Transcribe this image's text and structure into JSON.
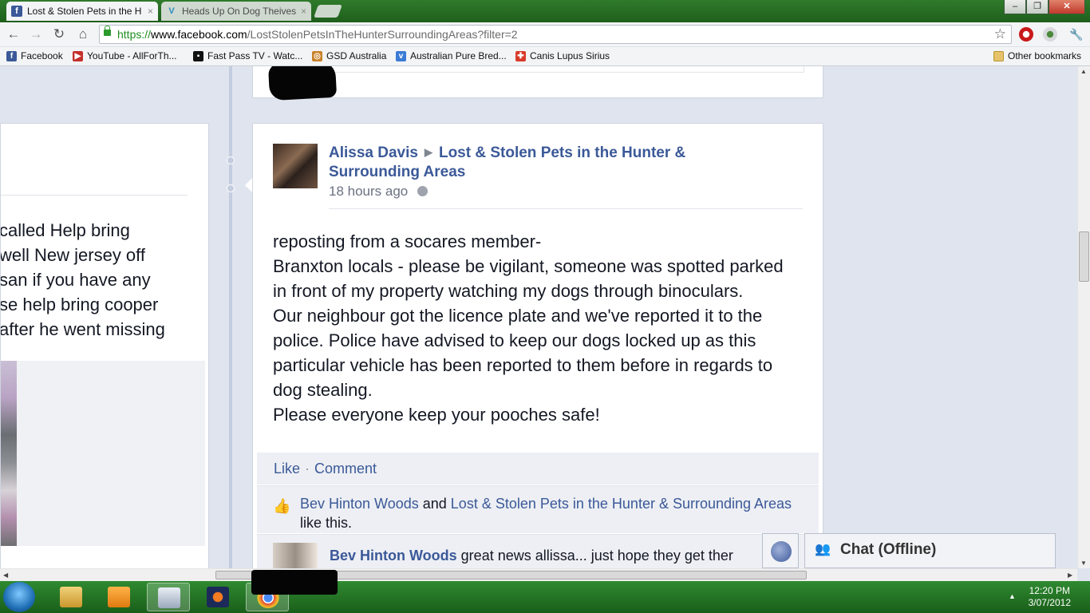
{
  "browser": {
    "tabs": [
      {
        "title": "Lost & Stolen Pets in the H",
        "active": true
      },
      {
        "title": "Heads Up On Dog Theives",
        "active": false
      }
    ],
    "close_glyph": "×",
    "window_controls": {
      "minimize": "–",
      "maximize": "❐",
      "close": "✕"
    },
    "url": {
      "scheme": "https://",
      "domain": "www.facebook.com",
      "path": "/LostStolenPetsInTheHunterSurroundingAreas?filter=2"
    },
    "nav": {
      "back": "←",
      "forward": "→",
      "reload": "↻",
      "home": "⌂",
      "star": "☆",
      "menu": "🔧"
    },
    "bookmarks": [
      {
        "label": "Facebook",
        "icon_color": "#3b5998",
        "glyph": "f"
      },
      {
        "label": "YouTube - AllForTh...",
        "icon_color": "#c4302b",
        "glyph": "▶"
      },
      {
        "label": "Fast Pass TV - Watc...",
        "icon_color": "#111111",
        "glyph": "▪"
      },
      {
        "label": "GSD Australia",
        "icon_color": "#c9822a",
        "glyph": "◎"
      },
      {
        "label": "Australian Pure Bred...",
        "icon_color": "#3a7bd5",
        "glyph": "v"
      },
      {
        "label": "Canis Lupus Sirius",
        "icon_color": "#d93a2b",
        "glyph": "✚"
      }
    ],
    "other_bookmarks": "Other bookmarks"
  },
  "left_card": {
    "lines": [
      "called Help bring",
      "well New jersey off",
      "san if you have any",
      "se help bring cooper",
      "after he went missing"
    ]
  },
  "post": {
    "author": "Alissa Davis",
    "separator": "▶",
    "target": "Lost & Stolen Pets in the Hunter & Surrounding Areas",
    "time": "18 hours ago",
    "body_lines": [
      "reposting from a socares member-",
      "Branxton locals - please be vigilant, someone was spotted parked",
      "in front of my property watching my dogs through binoculars.",
      "Our neighbour got the licence plate and we've reported it to the",
      "police. Police have advised to keep our dogs locked up as this",
      "particular vehicle has been reported to them before in regards to",
      "dog stealing.",
      "Please everyone keep your pooches safe!"
    ],
    "actions": {
      "like": "Like",
      "dot": "·",
      "comment": "Comment"
    },
    "likes": {
      "user": "Bev Hinton Woods",
      "and": " and ",
      "page": "Lost & Stolen Pets in the Hunter & Surrounding Areas",
      "suffix": " like this."
    },
    "comment": {
      "author": "Bev Hinton Woods",
      "text": " great news allissa... just hope they get ther"
    }
  },
  "chat": {
    "label": "Chat (Offline)"
  },
  "taskbar": {
    "time": "12:20 PM",
    "date": "3/07/2012",
    "tray_arrow": "▲"
  },
  "colors": {
    "fb_blue": "#3b5998",
    "taskbar_green": "#2f8a30"
  }
}
